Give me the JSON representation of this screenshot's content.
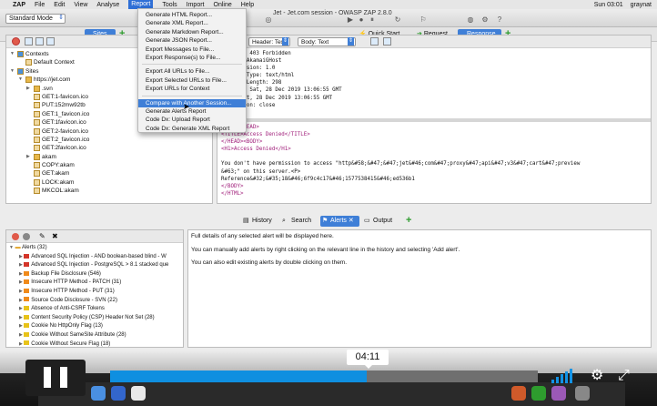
{
  "menubar": {
    "apple": "",
    "items": [
      "ZAP",
      "File",
      "Edit",
      "View",
      "Analyse",
      "Report",
      "Tools",
      "Import",
      "Online",
      "Help"
    ],
    "active_index": 5,
    "clock": "Sun 03:01",
    "user": "graynat"
  },
  "window": {
    "title": "Jet - Jet.com session - OWASP ZAP 2.8.0",
    "mode": "Standard Mode"
  },
  "tabs": {
    "sites": "Sites",
    "quick_start": "Quick Start",
    "request": "Request",
    "response": "Response"
  },
  "report_menu": {
    "items": [
      "Generate HTML Report...",
      "Generate XML Report...",
      "Generate Markdown Report...",
      "Generate JSON Report...",
      "Export Messages to File...",
      "Export Response(s) to File...",
      "Export All URLs to File...",
      "Export Selected URLs to File...",
      "Export URLs for Context",
      "Compare with Another Session...",
      "Generate Alerts Report",
      "Code Dx: Upload Report",
      "Code Dx: Generate XML Report"
    ],
    "highlighted_index": 9
  },
  "tree": {
    "rows": [
      {
        "label": "Contexts",
        "indent": 0,
        "twisty": "▼"
      },
      {
        "label": "Default Context",
        "indent": 1,
        "twisty": ""
      },
      {
        "label": "Sites",
        "indent": 0,
        "twisty": "▼"
      },
      {
        "label": "https://jet.com",
        "indent": 1,
        "twisty": "▼"
      },
      {
        "label": ".svn",
        "indent": 2,
        "twisty": "▶"
      },
      {
        "label": "GET:1-favicon.ico",
        "indent": 2,
        "twisty": ""
      },
      {
        "label": "PUT:152mw92tb",
        "indent": 2,
        "twisty": ""
      },
      {
        "label": "GET:1_favicon.ico",
        "indent": 2,
        "twisty": ""
      },
      {
        "label": "GET:1favicon.ico",
        "indent": 2,
        "twisty": ""
      },
      {
        "label": "GET:2-favicon.ico",
        "indent": 2,
        "twisty": ""
      },
      {
        "label": "GET:2_favicon.ico",
        "indent": 2,
        "twisty": ""
      },
      {
        "label": "GET:2favicon.ico",
        "indent": 2,
        "twisty": ""
      },
      {
        "label": "akam",
        "indent": 2,
        "twisty": "▶"
      },
      {
        "label": "COPY:akam",
        "indent": 2,
        "twisty": ""
      },
      {
        "label": "GET:akam",
        "indent": 2,
        "twisty": ""
      },
      {
        "label": "LOCK:akam",
        "indent": 2,
        "twisty": ""
      },
      {
        "label": "MKCOL:akam",
        "indent": 2,
        "twisty": ""
      }
    ]
  },
  "response": {
    "header_select": "Header: Text",
    "body_select": "Body: Text",
    "header_lines": [
      "HTTP/1.1 403 Forbidden",
      "Server: AkamaiGHost",
      "Mime-Version: 1.0",
      "Content-Type: text/html",
      "Content-Length: 298",
      "Expires: Sat, 28 Dec 2019 13:06:55 GMT",
      "Date: Sat, 28 Dec 2019 13:06:55 GMT",
      "Connection: close"
    ],
    "body_lines": [
      "<HTML><HEAD>",
      "<TITLE>Access Denied</TITLE>",
      "</HEAD><BODY>",
      "<H1>Access Denied</H1>",
      "",
      "You don't have permission to access \"http&#58;&#47;&#47;jet&#46;com&#47;proxy&#47;api&#47;v3&#47;cart&#47;preview",
      "&#63;\" on this server.<P>",
      "Reference&#32;&#35;18&#46;6f9c4c17&#46;1577538415&#46;ed536b1",
      "</BODY>",
      "</HTML>"
    ]
  },
  "bottom_tabs": {
    "history": "History",
    "search": "Search",
    "alerts": "Alerts",
    "output": "Output"
  },
  "alerts": {
    "root": "Alerts (32)",
    "items": [
      {
        "label": "Advanced SQL Injection - AND boolean-based blind - W",
        "flag": "red"
      },
      {
        "label": "Advanced SQL Injection - PostgreSQL > 8.1 stacked que",
        "flag": "red"
      },
      {
        "label": "Backup File Disclosure (546)",
        "flag": "orange"
      },
      {
        "label": "Insecure HTTP Method - PATCH (31)",
        "flag": "orange"
      },
      {
        "label": "Insecure HTTP Method - PUT (31)",
        "flag": "orange"
      },
      {
        "label": "Source Code Disclosure - SVN (22)",
        "flag": "orange"
      },
      {
        "label": "Absence of Anti-CSRF Tokens",
        "flag": "yellow"
      },
      {
        "label": "Content Security Policy (CSP) Header Not Set (28)",
        "flag": "yellow"
      },
      {
        "label": "Cookie No HttpOnly Flag (13)",
        "flag": "yellow"
      },
      {
        "label": "Cookie Without SameSite Attribute (28)",
        "flag": "yellow"
      },
      {
        "label": "Cookie Without Secure Flag (18)",
        "flag": "yellow"
      }
    ],
    "info": [
      "Full details of any selected alert will be displayed here.",
      "You can manually add alerts by right clicking on the relevant line in the history and selecting 'Add alert'.",
      "You can also edit existing alerts by double clicking on them."
    ]
  },
  "video": {
    "time": "04:11",
    "progress": 0.6
  },
  "colors": {
    "accent": "#3f7fd7",
    "progress": "#0f8fe0"
  }
}
